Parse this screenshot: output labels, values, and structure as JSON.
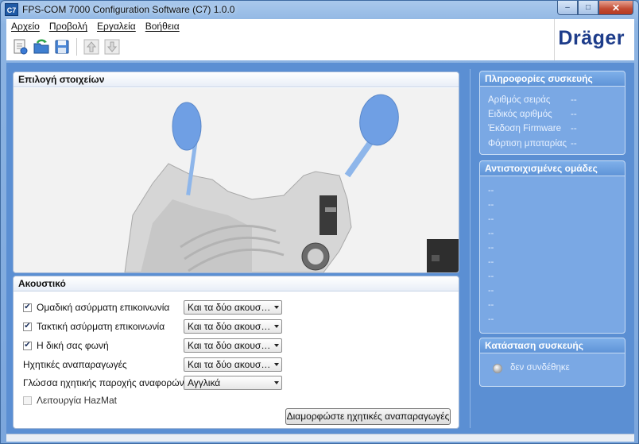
{
  "window": {
    "title": "FPS-COM 7000 Configuration Software (C7) 1.0.0",
    "app_icon_text": "C7",
    "minimize_symbol": "–",
    "maximize_symbol": "□",
    "close_symbol": "✕"
  },
  "menu": {
    "items": [
      "Αρχείο",
      "Προβολή",
      "Εργαλεία",
      "Βοήθεια"
    ]
  },
  "toolbar": {
    "icons": [
      "open-document-icon",
      "refresh-folder-icon",
      "save-disk-icon",
      "upload-arrow-icon",
      "download-arrow-icon"
    ]
  },
  "brand": {
    "logo": "Dräger",
    "color": "#1d3c8a"
  },
  "selection_panel": {
    "title": "Επιλογή στοιχείων"
  },
  "earpiece_panel": {
    "title": "Ακουστικό",
    "rows": [
      {
        "label": "Ομαδική ασύρματη επικοινωνία",
        "checked": true,
        "value": "Και τα δύο ακουστι..."
      },
      {
        "label": "Τακτική ασύρματη επικοινωνία",
        "checked": true,
        "value": "Και τα δύο ακουστι..."
      },
      {
        "label": "Η δική σας φωνή",
        "checked": true,
        "value": "Και τα δύο ακουστι..."
      },
      {
        "label": "Ηχητικές αναπαραγωγές",
        "value": "Και τα δύο ακουστι..."
      },
      {
        "label": "Γλώσσα ηχητικής παροχής αναφορών",
        "value": "Αγγλικά"
      },
      {
        "label": "Λειτουργία HazMat",
        "checked": false,
        "disabled": true
      }
    ],
    "configure_button": "Διαμορφώστε ηχητικές αναπαραγωγές"
  },
  "device_info": {
    "title": "Πληροφορίες συσκευής",
    "rows": [
      {
        "key": "Αριθμός σειράς",
        "value": "--"
      },
      {
        "key": "Ειδικός αριθμός",
        "value": "--"
      },
      {
        "key": "Έκδοση Firmware",
        "value": "--"
      },
      {
        "key": "Φόρτιση μπαταρίας",
        "value": "--"
      }
    ]
  },
  "matched_groups": {
    "title": "Αντιστοιχισμένες ομάδες",
    "items": [
      "--",
      "--",
      "--",
      "--",
      "--",
      "--",
      "--",
      "--",
      "--",
      "--"
    ]
  },
  "device_status": {
    "title": "Κατάσταση συσκευής",
    "status": "δεν συνδέθηκε"
  },
  "colors": {
    "accent_blue": "#5b8fd3",
    "panel_blue": "#7aa8e4",
    "device_part_blue": "#6f9fe4"
  }
}
